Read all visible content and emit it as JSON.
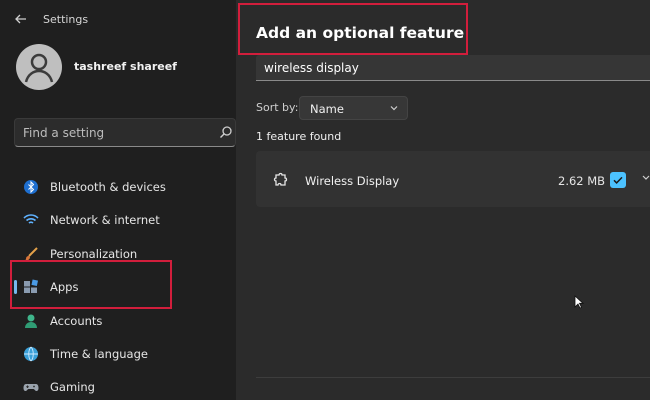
{
  "window": {
    "title": "Settings",
    "back_icon": "arrow-left-icon"
  },
  "user": {
    "name": "tashreef shareef",
    "avatar_icon": "person-icon"
  },
  "search": {
    "placeholder": "Find a setting",
    "icon": "search-icon"
  },
  "nav": {
    "items": [
      {
        "label": "Bluetooth & devices",
        "icon": "bluetooth-icon"
      },
      {
        "label": "Network & internet",
        "icon": "wifi-icon"
      },
      {
        "label": "Personalization",
        "icon": "brush-icon"
      },
      {
        "label": "Apps",
        "icon": "apps-icon",
        "active": true
      },
      {
        "label": "Accounts",
        "icon": "accounts-icon"
      },
      {
        "label": "Time & language",
        "icon": "globe-icon"
      },
      {
        "label": "Gaming",
        "icon": "gamepad-icon"
      }
    ]
  },
  "dialog": {
    "title": "Add an optional feature",
    "search_value": "wireless display",
    "sort_label": "Sort by:",
    "sort_value": "Name",
    "found_text": "1 feature found",
    "features": [
      {
        "name": "Wireless Display",
        "size": "2.62 MB",
        "checked": true,
        "icon": "puzzle-icon"
      }
    ]
  },
  "colors": {
    "accent": "#4cc2ff",
    "highlight": "#d21e3c",
    "active_indicator": "#76b9ed"
  }
}
